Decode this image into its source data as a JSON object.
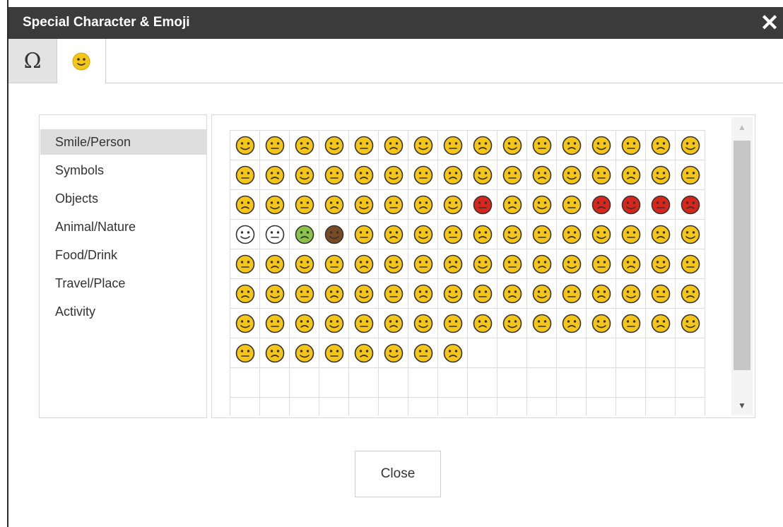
{
  "dialog": {
    "title": "Special Character & Emoji",
    "close_icon_glyph": "✕"
  },
  "tabs": [
    {
      "label": "Ω",
      "name": "symbols"
    },
    {
      "icon": "smiley-face-icon",
      "name": "emoji",
      "active": true
    }
  ],
  "categories": [
    {
      "label": "Smile/Person",
      "active": true
    },
    {
      "label": "Symbols"
    },
    {
      "label": "Objects"
    },
    {
      "label": "Animal/Nature"
    },
    {
      "label": "Food/Drink"
    },
    {
      "label": "Travel/Place"
    },
    {
      "label": "Activity"
    }
  ],
  "emoji_grid": {
    "columns": 16,
    "emojis": [
      "😁",
      "😂",
      "😃",
      "😄",
      "😅",
      "😆",
      "😉",
      "😊",
      "😋",
      "😎",
      "😍",
      "😘",
      "😚",
      "☺",
      "😐",
      "😶",
      "😏",
      "😣",
      "😥",
      "😪",
      "😫",
      "😌",
      "😜",
      "😝",
      "😒",
      "😓",
      "😔",
      "😲",
      "☹",
      "😖",
      "😞",
      "😤",
      "😢",
      "😭",
      "😨",
      "😩",
      "😰",
      "😱",
      "😳",
      "😵",
      "😡",
      "😠",
      "😷",
      "😇",
      "😈",
      "👿",
      "👹",
      "👺",
      "💀",
      "👻",
      "👽",
      "💩",
      "😺",
      "😸",
      "😹",
      "😻",
      "😼",
      "😽",
      "🙀",
      "😿",
      "😾",
      "👶",
      "👦",
      "👧",
      "👨",
      "👩",
      "👵",
      "💂",
      "👮",
      "👷",
      "👳",
      "👲",
      "🎅",
      "👱",
      "👰",
      "👼",
      "🎅",
      "🙍",
      "🙎",
      "🙅",
      "🙆",
      "💁",
      "🙋",
      "🙇",
      "💆",
      "🚶",
      "🏃",
      "💃",
      "👯",
      "👤",
      "👪",
      "💏",
      "💑",
      "👭",
      "💪",
      "👈",
      "👉",
      "☝",
      "👆",
      "👇",
      "✌",
      "✋",
      "👌",
      "👍",
      "👎",
      "✊",
      "👊",
      "👋",
      "👏",
      "✍",
      "👐",
      "🙌",
      "🙏",
      "💅",
      "👂",
      "👃",
      "👣",
      "👀",
      "👅",
      "👄"
    ],
    "total_cells": 160
  },
  "scrollbar": {
    "up_arrow": "▲",
    "down_arrow": "▼"
  },
  "footer": {
    "close_label": "Close"
  },
  "colors": {
    "titlebar": "#3b3b3b",
    "active_category": "#dedede",
    "emoji_yellow": "#f5c518",
    "emoji_outline": "#333333"
  }
}
